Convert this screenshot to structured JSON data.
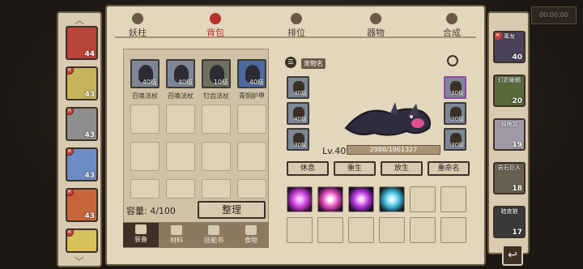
{
  "tabs": [
    "妖柱",
    "背包",
    "排位",
    "器物",
    "合成"
  ],
  "active_tab": "背包",
  "heroes": [
    {
      "level": "44",
      "color": "#b8443a"
    },
    {
      "level": "43",
      "color": "#c7b35a"
    },
    {
      "level": "43",
      "color": "#8e8e8e"
    },
    {
      "level": "43",
      "color": "#6d8cc4"
    },
    {
      "level": "43",
      "color": "#c7653a"
    },
    {
      "level": "43",
      "color": "#d7c25a"
    }
  ],
  "bag": {
    "items": [
      {
        "name": "召唤法杖",
        "level": "40级"
      },
      {
        "name": "召唤法杖",
        "level": "40级"
      },
      {
        "name": "钉齿法杖",
        "level": "10级"
      },
      {
        "name": "青铜护甲",
        "level": "40级"
      }
    ],
    "capacity": "容量: 4/100",
    "sort_button": "整理",
    "subtabs": [
      "装备",
      "材料",
      "技能书",
      "食物"
    ]
  },
  "pet": {
    "tag": "宠物名",
    "level": "Lv.40",
    "exp": "2986/1961327",
    "left_equips": [
      "40级",
      "40级",
      "30级"
    ],
    "right_equips": [
      "30级",
      "30级",
      "30级"
    ],
    "buttons": [
      "休息",
      "重生",
      "放生",
      "重命名"
    ]
  },
  "pet_list": [
    {
      "name": "毒龙",
      "level": "40"
    },
    {
      "name": "灯奶蜥蜴",
      "level": "20"
    },
    {
      "name": "独角兽",
      "level": "19"
    },
    {
      "name": "岩石巨人",
      "level": "18"
    },
    {
      "name": "暗夜狼",
      "level": "17"
    }
  ],
  "corner_button": "↩",
  "ghost_label": "00:00:00"
}
